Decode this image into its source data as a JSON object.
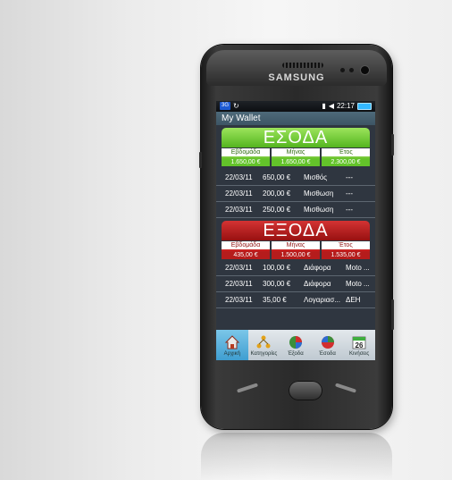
{
  "device": {
    "brand": "SAMSUNG"
  },
  "status": {
    "network": "3G",
    "time": "22:17"
  },
  "app": {
    "title": "My Wallet"
  },
  "income": {
    "title": "ΕΣΟΔΑ",
    "headers": [
      "Εβδομάδα",
      "Μήνας",
      "Έτος"
    ],
    "values": [
      "1.650,00 €",
      "1.650,00 €",
      "2.300,00 €"
    ],
    "rows": [
      [
        "22/03/11",
        "650,00 €",
        "Μισθός",
        "---"
      ],
      [
        "22/03/11",
        "200,00 €",
        "Μισθωση",
        "---"
      ],
      [
        "22/03/11",
        "250,00 €",
        "Μισθωση",
        "---"
      ]
    ]
  },
  "expenses": {
    "title": "ΕΞΟΔΑ",
    "headers": [
      "Εβδομάδα",
      "Μήνας",
      "Έτος"
    ],
    "values": [
      "435,00 €",
      "1.500,00 €",
      "1.535,00 €"
    ],
    "rows": [
      [
        "22/03/11",
        "100,00 €",
        "Διάφορα",
        "Moto ..."
      ],
      [
        "22/03/11",
        "300,00 €",
        "Διάφορα",
        "Moto ..."
      ],
      [
        "22/03/11",
        "35,00 €",
        "Λογαριασ...",
        "ΔΕΗ"
      ]
    ]
  },
  "tabs": [
    {
      "label": "Αρχική",
      "icon": "home-icon",
      "active": true
    },
    {
      "label": "Κατηγορίες",
      "icon": "categories-icon",
      "active": false
    },
    {
      "label": "Έξοδα",
      "icon": "pie-chart-icon",
      "active": false
    },
    {
      "label": "Έσοδα",
      "icon": "pie-chart-icon",
      "active": false
    },
    {
      "label": "Κινήσεις",
      "icon": "calendar-icon",
      "active": false,
      "badge": "26"
    }
  ],
  "colors": {
    "income": "#63c32a",
    "expense": "#b51c1c",
    "accent": "#3f9ed1"
  }
}
